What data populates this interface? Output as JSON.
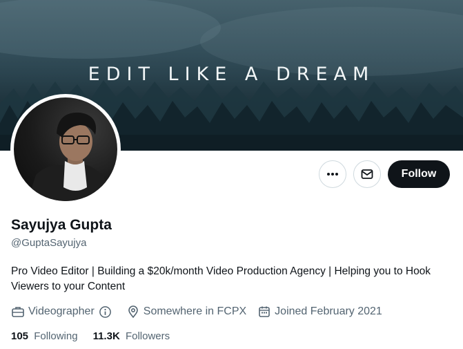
{
  "banner": {
    "title": "EDIT LIKE A DREAM"
  },
  "profile": {
    "name": "Sayujya Gupta",
    "handle": "@GuptaSayujya",
    "bio": "Pro Video Editor | Building a $20k/month Video Production Agency | Helping you to Hook Viewers to your Content",
    "profession": "Videographer",
    "location": "Somewhere in FCPX",
    "joined": "Joined February 2021"
  },
  "actions": {
    "follow_label": "Follow"
  },
  "stats": {
    "following_count": "105",
    "following_label": "Following",
    "followers_count": "11.3K",
    "followers_label": "Followers"
  },
  "icons": {
    "more": "more-icon",
    "message": "mail-icon",
    "profession": "briefcase-icon",
    "info": "info-icon",
    "location": "location-pin-icon",
    "joined": "calendar-icon"
  },
  "colors": {
    "follow_bg": "#0f1419",
    "secondary_text": "#536471",
    "border": "#cfd9de"
  }
}
